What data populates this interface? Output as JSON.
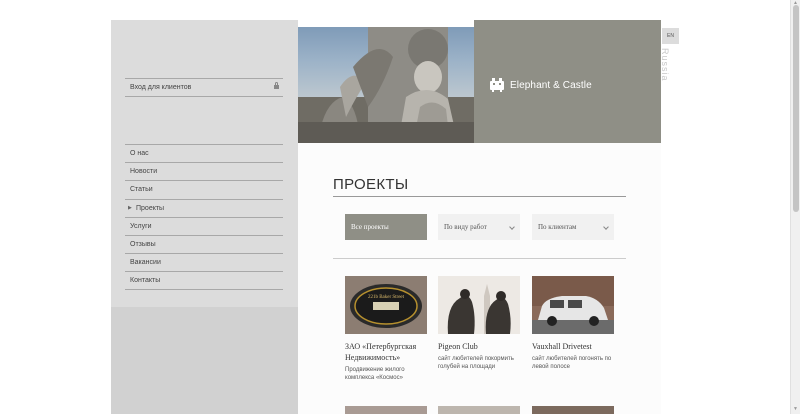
{
  "sidebar": {
    "login_label": "Вход для клиентов",
    "nav": [
      {
        "label": "О нас"
      },
      {
        "label": "Новости"
      },
      {
        "label": "Статьи"
      },
      {
        "label": "Проекты",
        "active": true
      },
      {
        "label": "Услуги"
      },
      {
        "label": "Отзывы"
      },
      {
        "label": "Вакансии"
      },
      {
        "label": "Контакты"
      }
    ]
  },
  "header": {
    "brand_name": "Elephant & Castle",
    "lang_switch": "EN",
    "region_label": "Russia"
  },
  "main": {
    "title": "ПРОЕКТЫ",
    "filters": {
      "all": "Все проекты",
      "by_work": "По виду работ",
      "by_client": "По клиентам"
    },
    "projects": [
      {
        "name": "ЗАО «Петербургская Недвижимость»",
        "desc": "Продвижение жилого комплекса «Космос»",
        "thumb_text": "221b Baker Street"
      },
      {
        "name": "Pigeon Club",
        "desc": "сайт любителей покормить голубей на площади"
      },
      {
        "name": "Vauxhall Drivetest",
        "desc": "сайт любителей погонять по левой полосе"
      }
    ]
  },
  "colors": {
    "brand_bg": "#8f8f86",
    "sidebar_bg": "#dcdcdc",
    "filter_active_bg": "#8f8f86"
  }
}
